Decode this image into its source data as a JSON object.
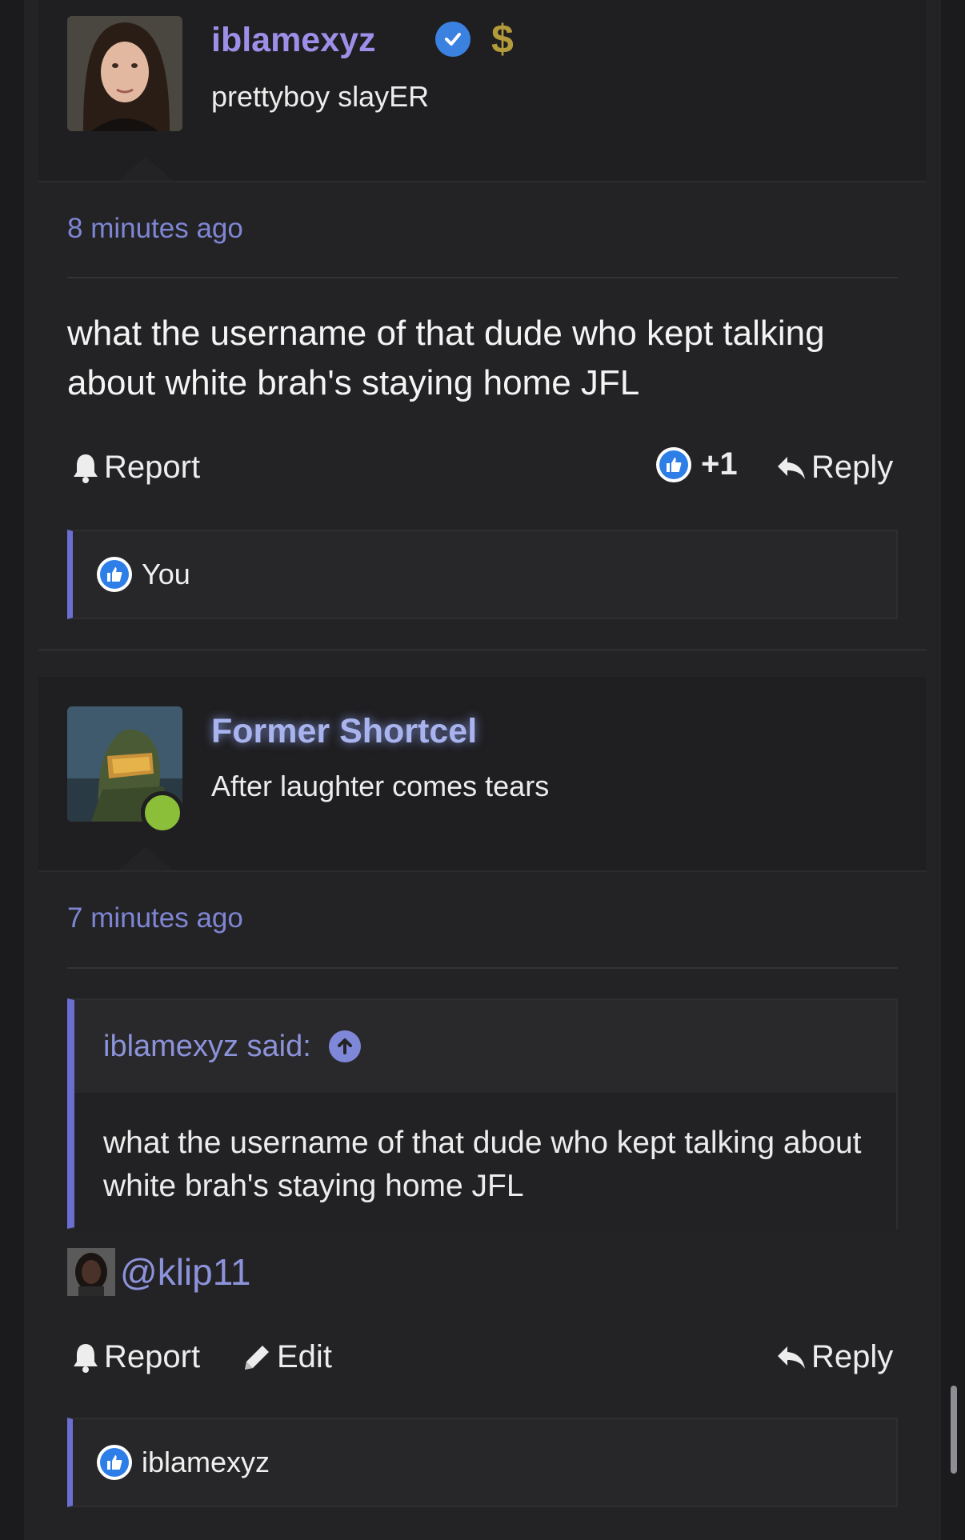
{
  "post1": {
    "username": "iblamexyz",
    "user_title": "prettyboy slayER",
    "time": "8 minutes ago",
    "message": "what the username of that dude who kept talking about white brah's staying home JFL",
    "actions": {
      "report": "Report",
      "like_count": "+1",
      "reply": "Reply"
    },
    "liked_by": "You",
    "badges": [
      "verified-icon",
      "dollar-icon"
    ]
  },
  "post2": {
    "username": "Former Shortcel",
    "user_title": "After laughter comes tears",
    "time": "7 minutes ago",
    "quote": {
      "author": "iblamexyz said:",
      "text": "what the username of that dude who kept talking about white brah's staying home JFL"
    },
    "mention": "@klip11",
    "actions": {
      "report": "Report",
      "edit": "Edit",
      "reply": "Reply"
    },
    "liked_by": "iblamexyz",
    "online_status_color": "#8bbf3a"
  },
  "colors": {
    "accent": "#6a6ed0",
    "link": "#8d93db",
    "username": "#9d8ee8",
    "like_blue": "#2d7ee6",
    "background": "#232325"
  }
}
